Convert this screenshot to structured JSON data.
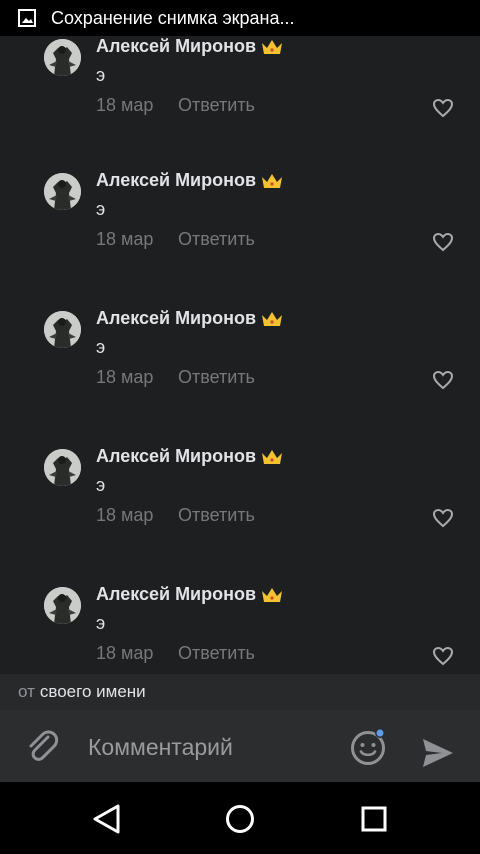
{
  "status_bar": {
    "text": "Сохранение снимка экрана..."
  },
  "comments": [
    {
      "author": "Алексей Миронов",
      "text": "э",
      "date": "18 мар",
      "reply": "Ответить"
    },
    {
      "author": "Алексей Миронов",
      "text": "э",
      "date": "18 мар",
      "reply": "Ответить"
    },
    {
      "author": "Алексей Миронов",
      "text": "э",
      "date": "18 мар",
      "reply": "Ответить"
    },
    {
      "author": "Алексей Миронов",
      "text": "э",
      "date": "18 мар",
      "reply": "Ответить"
    },
    {
      "author": "Алексей Миронов",
      "text": "э",
      "date": "18 мар",
      "reply": "Ответить"
    }
  ],
  "from_bar": {
    "prefix": "от",
    "name": "своего имени"
  },
  "composer": {
    "placeholder": "Комментарий"
  },
  "icons": {
    "status": "image-icon",
    "crown": "crown-icon",
    "like": "heart-icon",
    "attach": "paperclip-icon",
    "emoji": "emoji-icon",
    "send": "send-icon",
    "nav": [
      "back-icon",
      "home-icon",
      "recents-icon"
    ]
  },
  "colors": {
    "background": "#1e1f21",
    "secondary_text": "#76787a",
    "crown": "#f2c230",
    "emoji_dot": "#5e9ee8"
  }
}
